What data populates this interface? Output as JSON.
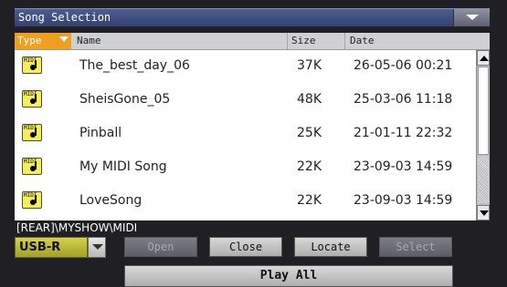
{
  "window": {
    "title": "Song Selection"
  },
  "columns": {
    "type": "Type",
    "name": "Name",
    "size": "Size",
    "date": "Date"
  },
  "files": [
    {
      "icon": "midi-file-icon",
      "badge": "MIDI",
      "name": "The_best_day_06",
      "size": "37K",
      "date": "26-05-06 00:21"
    },
    {
      "icon": "midi-file-icon",
      "badge": "MIDI",
      "name": "SheisGone_05",
      "size": "48K",
      "date": "25-03-06 11:18"
    },
    {
      "icon": "midi-file-icon",
      "badge": "MIDI",
      "name": "Pinball",
      "size": "25K",
      "date": "21-01-11 22:32"
    },
    {
      "icon": "midi-file-icon",
      "badge": "MIDI",
      "name": "My MIDI Song",
      "size": "22K",
      "date": "23-09-03 14:59"
    },
    {
      "icon": "midi-file-icon",
      "badge": "MIDI",
      "name": "LoveSong",
      "size": "22K",
      "date": "23-09-03 14:59"
    }
  ],
  "path": "[REAR]\\MYSHOW\\MIDI",
  "device": {
    "selected": "USB-R"
  },
  "buttons": {
    "open": "Open",
    "close": "Close",
    "locate": "Locate",
    "select": "Select",
    "play_all": "Play All"
  },
  "colors": {
    "title_bar": "#3b4a7c",
    "type_header": "#f0a020",
    "device_field": "#c9c73a"
  }
}
